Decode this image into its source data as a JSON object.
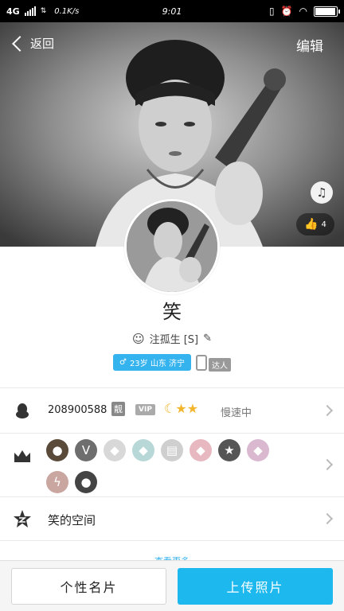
{
  "status_bar": {
    "network": "4G",
    "speed": "0.1K/s",
    "time": "9:01",
    "battery_level": 0.9
  },
  "header": {
    "back_label": "返回",
    "edit_label": "编辑",
    "like_count": "4"
  },
  "profile": {
    "nickname": "笑",
    "signature": "注孤生 [S]",
    "info_tag": "23岁 山东 济宁",
    "daren_label": "达人"
  },
  "qq_row": {
    "qq_number": "208900588",
    "pretty_badge": "靓",
    "vip_label": "VIP",
    "level_icons": [
      "moon",
      "star",
      "star"
    ],
    "speed_status": "慢速中"
  },
  "badges": [
    {
      "icon": "poop-icon",
      "color": "#5a4a3a"
    },
    {
      "icon": "cloud-v-icon",
      "color": "#6e6e6e"
    },
    {
      "icon": "diamond-icon",
      "color": "#d8d8d8"
    },
    {
      "icon": "diamond-icon",
      "color": "#b8d8d8"
    },
    {
      "icon": "book-icon",
      "color": "#cfcfcf"
    },
    {
      "icon": "diamond-icon",
      "color": "#e8b8c0"
    },
    {
      "icon": "star-icon",
      "color": "#555555"
    },
    {
      "icon": "diamond-icon",
      "color": "#d9b8d0"
    },
    {
      "icon": "lightning-icon",
      "color": "#c9a6a0"
    },
    {
      "icon": "bird-icon",
      "color": "#444444"
    }
  ],
  "zone": {
    "label": "笑的空间"
  },
  "see_more": "查看更多",
  "bottom": {
    "card_label": "个性名片",
    "upload_label": "上传照片"
  },
  "colors": {
    "accent": "#1cb8ee",
    "tag": "#35b3ee"
  }
}
